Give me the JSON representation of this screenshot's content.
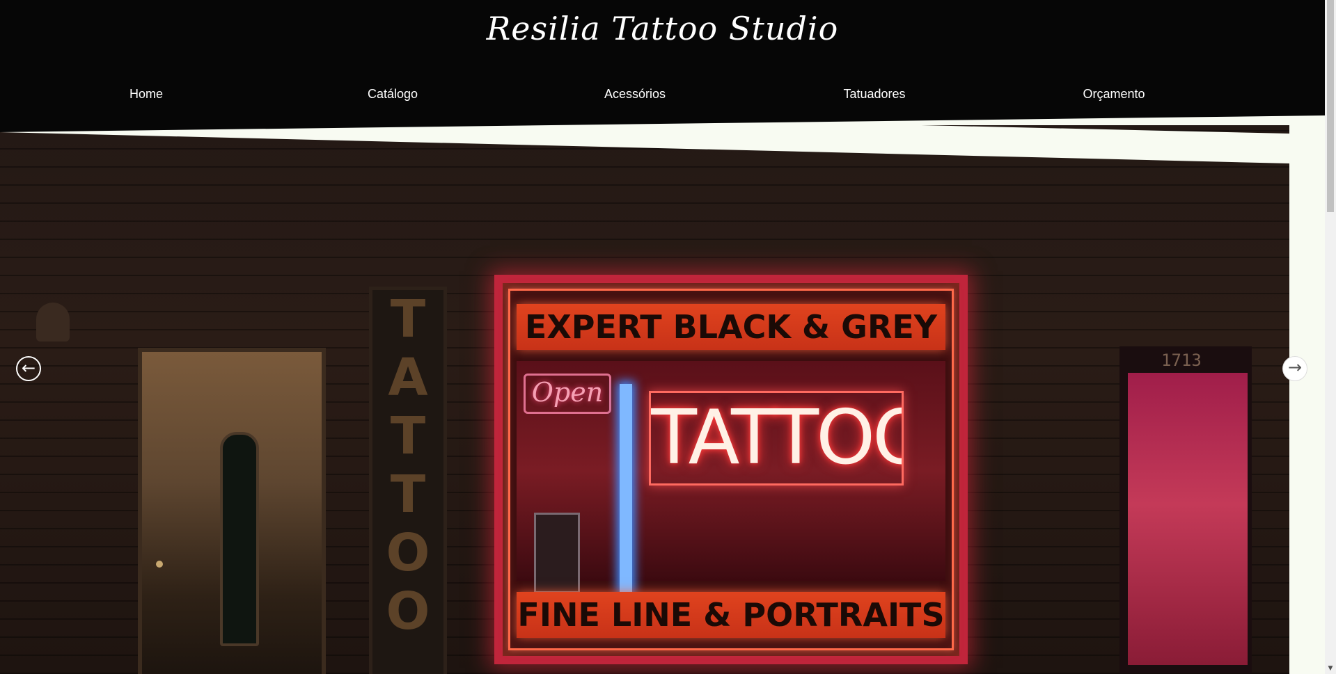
{
  "site": {
    "title": "Resilia Tattoo Studio"
  },
  "nav": {
    "items": [
      {
        "label": "Home"
      },
      {
        "label": "Catálogo"
      },
      {
        "label": "Acessórios"
      },
      {
        "label": "Tatuadores"
      },
      {
        "label": "Orçamento"
      }
    ]
  },
  "hero": {
    "sign_top": "EXPERT BLACK & GREY",
    "sign_bottom": "FINE LINE & PORTRAITS",
    "neon_text": "TATTOO",
    "open_sign": "Open",
    "vertical_sign": [
      "T",
      "A",
      "T",
      "T",
      "O",
      "O"
    ],
    "door_number": "1713"
  },
  "carousel": {
    "prev_icon": "arrow-left-circle-icon",
    "next_icon": "arrow-right-circle-icon"
  },
  "colors": {
    "header_bg": "#060606",
    "page_bg": "#f8fbf2",
    "neon_red": "#c0253b"
  }
}
